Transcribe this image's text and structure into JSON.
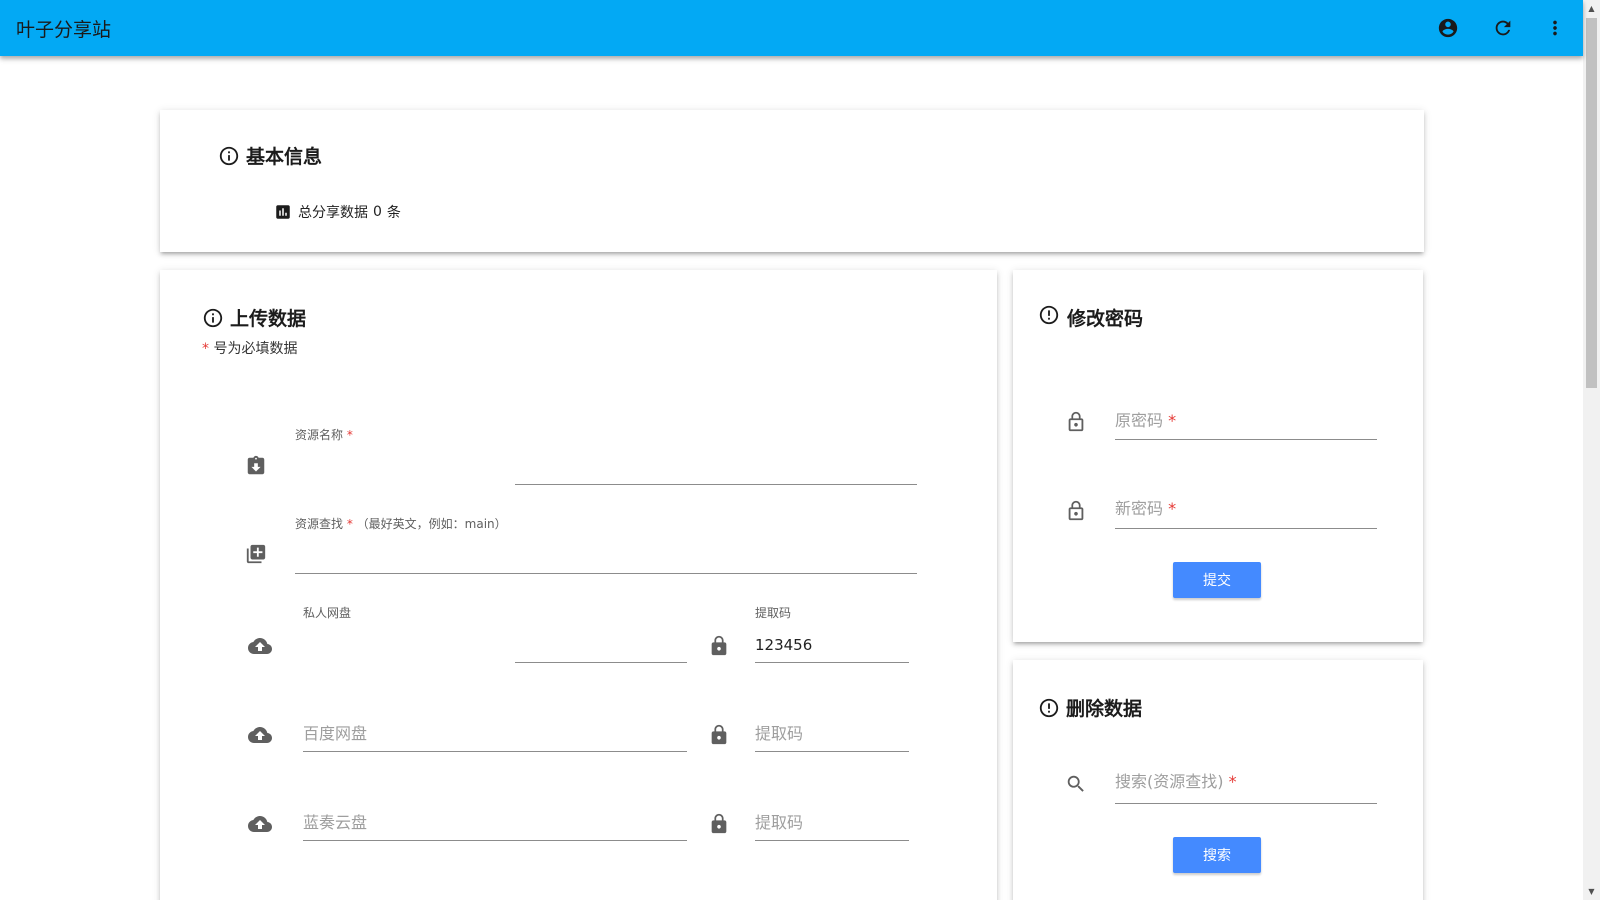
{
  "appbar": {
    "title": "叶子分享站",
    "icons": [
      "account-circle-icon",
      "refresh-icon",
      "more-vert-icon"
    ],
    "color": "#03a9f4"
  },
  "basic_info": {
    "title": "基本信息",
    "stat_prefix": "总分享数据",
    "stat_count": "0",
    "stat_suffix": "条"
  },
  "upload": {
    "title": "上传数据",
    "required_note_star": "*",
    "required_note": "号为必填数据",
    "resource_name_label": "资源名称",
    "resource_search_label": "资源查找",
    "resource_search_hint": "（最好英文，例如：main）",
    "private_disk_label": "私人网盘",
    "private_code_label": "提取码",
    "private_code_value": "123456",
    "baidu_placeholder": "百度网盘",
    "baidu_code_placeholder": "提取码",
    "lanzou_placeholder": "蓝奏云盘",
    "lanzou_code_placeholder": "提取码"
  },
  "change_password": {
    "title": "修改密码",
    "old_placeholder": "原密码",
    "new_placeholder": "新密码",
    "submit_label": "提交"
  },
  "delete_data": {
    "title": "删除数据",
    "search_placeholder": "搜索(资源查找)",
    "search_label": "搜索"
  },
  "accent_color": "#448aff",
  "required_color": "#e53935"
}
